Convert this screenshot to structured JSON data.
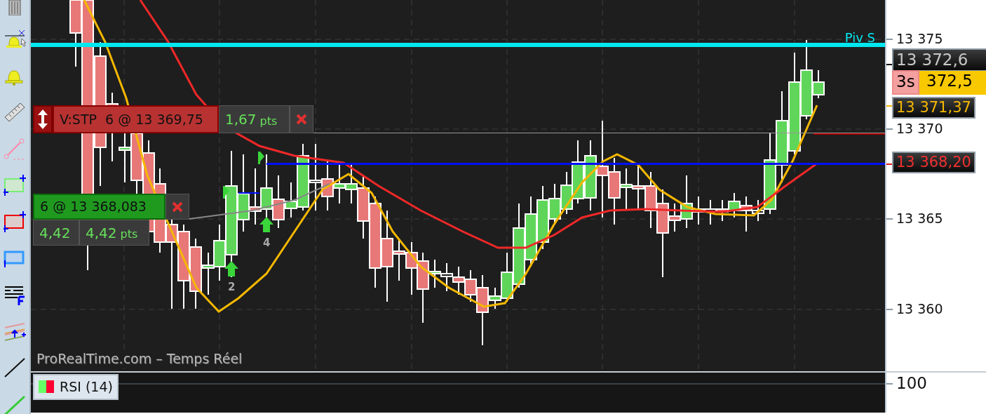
{
  "chart": {
    "pivot_label": "Piv S",
    "watermark": "ProRealTime.com – Temps Réel",
    "orders": [
      {
        "kind": "stop",
        "label": "V:STP  6 @ 13 369,75",
        "gain": "1,67",
        "unit": "pts"
      },
      {
        "kind": "position",
        "label": "6 @ 13 368,083",
        "gain_short": "4,42",
        "gain": "4,42",
        "unit": "pts"
      }
    ],
    "signals": [
      {
        "count": "2"
      },
      {
        "count": "4"
      }
    ]
  },
  "price_axis": {
    "ticks": [
      "13 375",
      "13 370",
      "13 365",
      "13 360"
    ],
    "price_tags": [
      {
        "kind": "last",
        "text": "13 372,6"
      },
      {
        "kind": "timer",
        "timer": "3s",
        "text": "372,5"
      },
      {
        "kind": "average",
        "text": "13 371,37"
      },
      {
        "kind": "stop",
        "text": "13 368,20"
      }
    ]
  },
  "rsi_panel": {
    "legend": "RSI (14)",
    "ticks": [
      "100"
    ]
  }
}
